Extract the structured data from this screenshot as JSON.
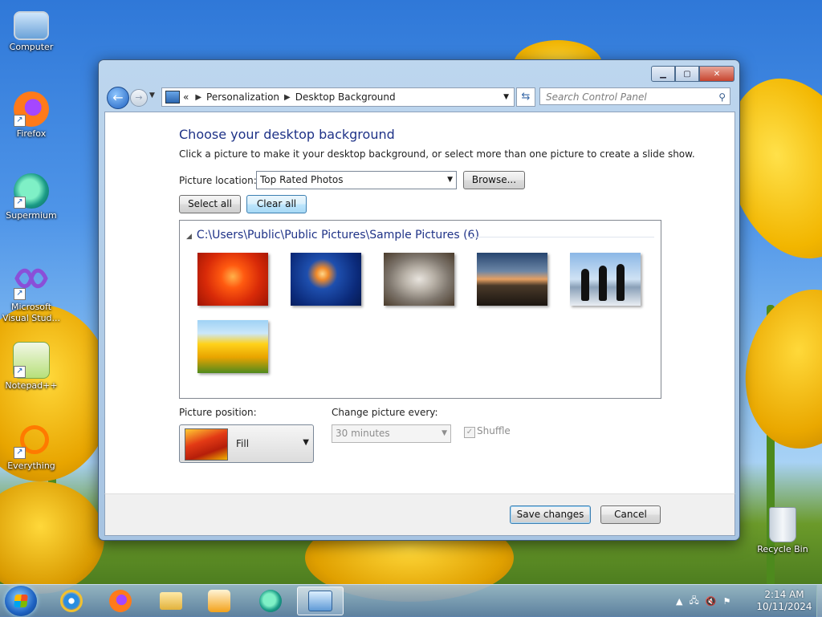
{
  "desktop": {
    "icons": [
      {
        "label": "Computer",
        "icon": "computer-icon"
      },
      {
        "label": "Firefox",
        "icon": "firefox-icon"
      },
      {
        "label": "Supermium",
        "icon": "supermium-icon"
      },
      {
        "label": "Microsoft Visual Stud...",
        "icon": "visual-studio-icon"
      },
      {
        "label": "Notepad++",
        "icon": "notepadpp-icon"
      },
      {
        "label": "Everything",
        "icon": "everything-icon"
      },
      {
        "label": "Recycle Bin",
        "icon": "recycle-bin-icon"
      }
    ]
  },
  "window": {
    "title_buttons": {
      "minimize": "minimize-icon",
      "maximize": "maximize-icon",
      "close": "close-icon"
    },
    "address": {
      "chevrons": "«",
      "crumbs": [
        "Personalization",
        "Desktop Background"
      ]
    },
    "search": {
      "placeholder": "Search Control Panel"
    },
    "heading": "Choose your desktop background",
    "description": "Click a picture to make it your desktop background, or select more than one picture to create a slide show.",
    "picture_location": {
      "label": "Picture location:",
      "value": "Top Rated Photos"
    },
    "browse_label": "Browse...",
    "select_all_label": "Select all",
    "clear_all_label": "Clear all",
    "gallery": {
      "group_path": "C:\\Users\\Public\\Public Pictures\\Sample Pictures (6)",
      "pictures": [
        "Chrysanthemum",
        "Jellyfish",
        "Koala",
        "Lighthouse",
        "Penguins",
        "Tulips"
      ]
    },
    "picture_position": {
      "label": "Picture position:",
      "value": "Fill"
    },
    "change_picture": {
      "label": "Change picture every:",
      "value": "30 minutes"
    },
    "shuffle": {
      "label": "Shuffle",
      "checked": true,
      "enabled": false
    },
    "save_label": "Save changes",
    "cancel_label": "Cancel"
  },
  "taskbar": {
    "items": [
      "internet-explorer-icon",
      "firefox-icon",
      "file-explorer-icon",
      "media-player-icon",
      "supermium-icon",
      "control-panel-icon"
    ],
    "active_item": "control-panel-icon",
    "tray_icons": [
      "show-hidden-icons-chevron",
      "network-icon",
      "volume-muted-icon",
      "action-center-flag-icon"
    ],
    "time": "2:14 AM",
    "date": "10/11/2024"
  }
}
